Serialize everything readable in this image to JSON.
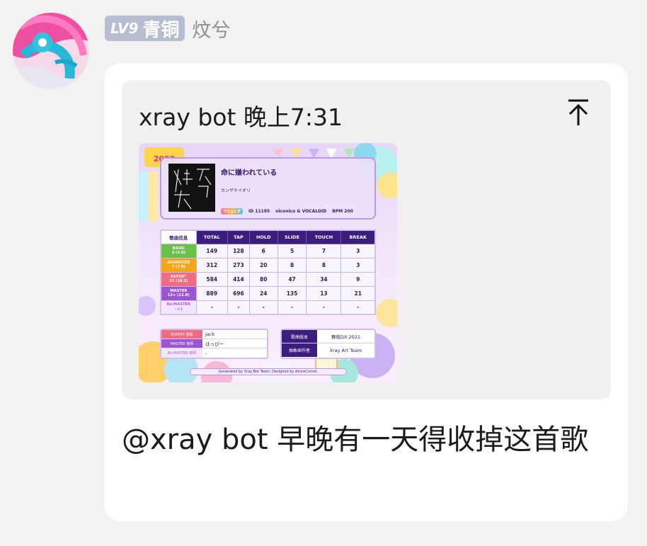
{
  "sender": {
    "avatar": "dragon-avatar",
    "level_label": "LV9",
    "rank_label": "青铜",
    "username": "炆兮"
  },
  "quote": {
    "author": "xray bot",
    "time": "晚上7:31",
    "jump_icon": "jump-to-top-icon",
    "card": {
      "event_logo": "舞萌 DX 2023",
      "song_title": "命に嫌われている",
      "artist": "カンザキイオリ",
      "dx_tag": "でらっくす",
      "song_id": "ID 11185",
      "category": "niconico & VOCALOID",
      "bpm": "BPM 200",
      "jacket_text": "嫌 命 长",
      "table": {
        "headers": [
          "歌曲信息",
          "TOTAL",
          "TAP",
          "HOLD",
          "SLIDE",
          "TOUCH",
          "BREAK"
        ],
        "rows": [
          {
            "level": "BASIC",
            "value": "3 (3.0)",
            "cells": [
              "149",
              "128",
              "6",
              "5",
              "7",
              "3"
            ]
          },
          {
            "level": "ADVANCED",
            "value": "7 (7.0)",
            "cells": [
              "312",
              "273",
              "20",
              "8",
              "8",
              "3"
            ]
          },
          {
            "level": "EXPERT",
            "value": "10 (10.2)",
            "cells": [
              "584",
              "414",
              "80",
              "47",
              "34",
              "9"
            ]
          },
          {
            "level": "MASTER",
            "value": "12+ (12.8)",
            "cells": [
              "889",
              "696",
              "24",
              "135",
              "13",
              "21"
            ]
          },
          {
            "level": "Re:MASTER",
            "value": "- (-)",
            "cells": [
              "-",
              "-",
              "-",
              "-",
              "-",
              "-"
            ]
          }
        ]
      },
      "charters": [
        {
          "label": "EXPERT 谱师",
          "value": "Jack"
        },
        {
          "label": "MASTER 谱师",
          "value": "はっぴー"
        },
        {
          "label": "Re:MASTER 谱师",
          "value": "-"
        }
      ],
      "info": [
        {
          "label": "歌曲版本",
          "value": "舞萌DX 2021"
        },
        {
          "label": "抽象画作者",
          "value": "Xray Art Team"
        }
      ],
      "footer": "Generated by Xray Bot Team. Designed by AzureComet."
    }
  },
  "message": {
    "text": "@xray bot 早晚有一天得收掉这首歌"
  },
  "colors": {
    "background": "#f2f2f2",
    "bubble": "#ffffff",
    "quote_card": "#f0f0f0",
    "level_badge": "#b7bdd0",
    "username": "#8e8e93",
    "table_header": "#3b1d7d"
  }
}
